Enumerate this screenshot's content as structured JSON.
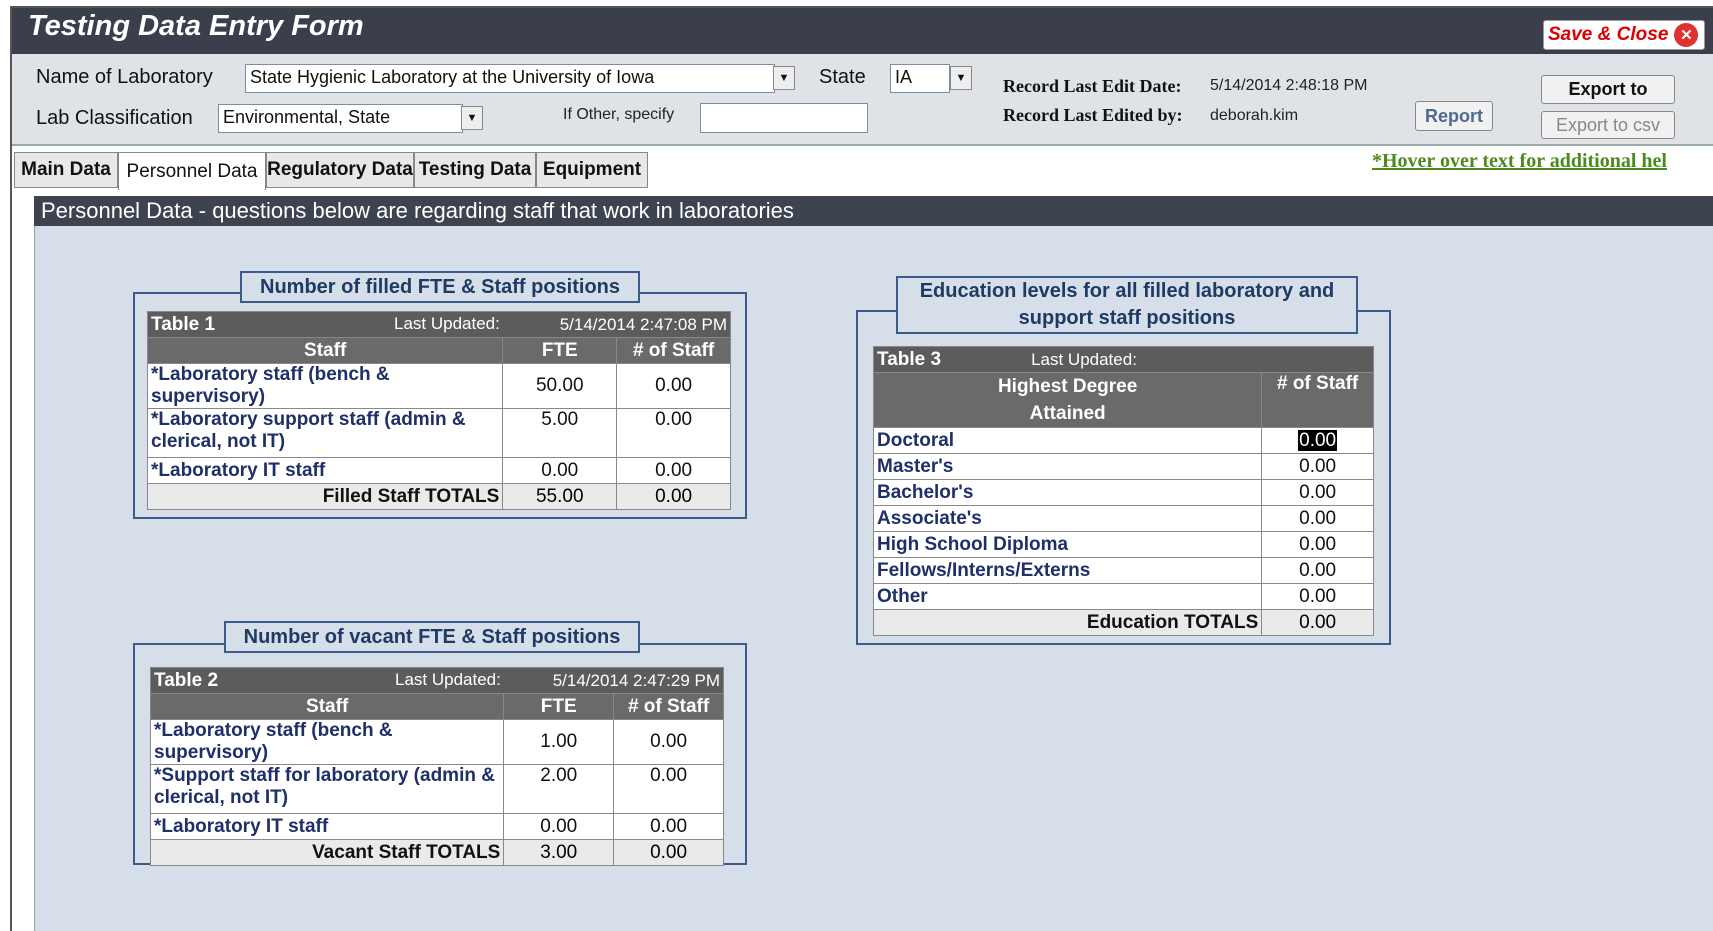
{
  "window": {
    "title": "Testing Data Entry Form",
    "save_close_label": "Save & Close"
  },
  "header": {
    "lab_name_label": "Name of Laboratory",
    "lab_name_value": "State Hygienic Laboratory at the University of Iowa",
    "state_label": "State",
    "state_value": "IA",
    "lab_class_label": "Lab Classification",
    "lab_class_value": "Environmental, State",
    "if_other_label": "If Other, specify",
    "if_other_value": "",
    "last_edit_date_label": "Record Last Edit Date:",
    "last_edit_date_value": "5/14/2014 2:48:18 PM",
    "last_edited_by_label": "Record Last Edited by:",
    "last_edited_by_value": "deborah.kim",
    "report_label": "Report",
    "export_to_label": "Export to",
    "export_csv_label": "Export to csv"
  },
  "tabs": [
    "Main Data",
    "Personnel Data",
    "Regulatory Data",
    "Testing Data",
    "Equipment"
  ],
  "hover_note": "*Hover over text for additional hel",
  "section_title": "Personnel Data - questions below are regarding staff that work in laboratories",
  "table1": {
    "group_title": "Number of filled FTE & Staff positions",
    "name": "Table 1",
    "last_updated_label": "Last Updated:",
    "last_updated_value": "5/14/2014 2:47:08 PM",
    "col_staff": "Staff",
    "col_fte": "FTE",
    "col_count": "# of Staff",
    "rows": [
      {
        "label": "*Laboratory staff (bench & supervisory)",
        "fte": "50.00",
        "count": "0.00"
      },
      {
        "label": "*Laboratory support staff (admin & clerical, not IT)",
        "fte": "5.00",
        "count": "0.00"
      },
      {
        "label": "*Laboratory IT staff",
        "fte": "0.00",
        "count": "0.00"
      }
    ],
    "total_label": "Filled Staff TOTALS",
    "total_fte": "55.00",
    "total_count": "0.00"
  },
  "table2": {
    "group_title": "Number of vacant FTE & Staff positions",
    "name": "Table 2",
    "last_updated_label": "Last Updated:",
    "last_updated_value": "5/14/2014 2:47:29 PM",
    "col_staff": "Staff",
    "col_fte": "FTE",
    "col_count": "# of Staff",
    "rows": [
      {
        "label": "*Laboratory staff (bench & supervisory)",
        "fte": "1.00",
        "count": "0.00"
      },
      {
        "label": "*Support staff for laboratory (admin & clerical, not IT)",
        "fte": "2.00",
        "count": "0.00"
      },
      {
        "label": "*Laboratory IT staff",
        "fte": "0.00",
        "count": "0.00"
      }
    ],
    "total_label": "Vacant Staff TOTALS",
    "total_fte": "3.00",
    "total_count": "0.00"
  },
  "table3": {
    "group_title_line1": "Education levels for all filled laboratory and",
    "group_title_line2": "support staff positions",
    "name": "Table 3",
    "last_updated_label": "Last Updated:",
    "last_updated_value": "",
    "col_degree_line1": "Highest Degree",
    "col_degree_line2": "Attained",
    "col_count": "# of Staff",
    "rows": [
      {
        "label": "Doctoral",
        "count": "0.00"
      },
      {
        "label": "Master's",
        "count": "0.00"
      },
      {
        "label": "Bachelor's",
        "count": "0.00"
      },
      {
        "label": "Associate's",
        "count": "0.00"
      },
      {
        "label": "High School Diploma",
        "count": "0.00"
      },
      {
        "label": "Fellows/Interns/Externs",
        "count": "0.00"
      },
      {
        "label": "Other",
        "count": "0.00"
      }
    ],
    "total_label": "Education TOTALS",
    "total_count": "0.00"
  }
}
